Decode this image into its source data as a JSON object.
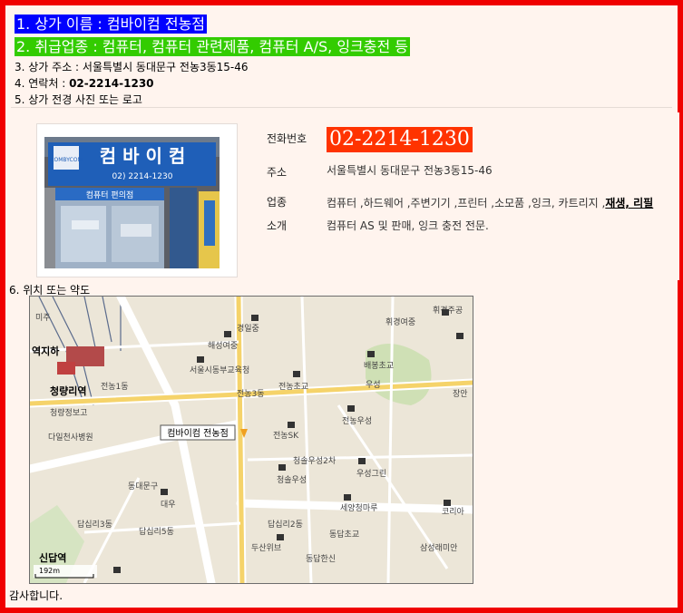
{
  "store": {
    "name_line": "1. 상가 이름 : 컴바이컴 전농점",
    "category_line": "2. 취급업종 : 컴퓨터, 컴퓨터 관련제품, 컴퓨터 A/S, 잉크충전 등",
    "address_line": "3. 상가 주소 : 서울특별시 동대문구 전농3동15-46",
    "contact_prefix": "4. 연락처 : ",
    "contact_phone": "02-2214-1230",
    "photo_line": "5. 상가 전경 사진 또는 로고",
    "map_line": "6. 위치 또는 약도",
    "thanks": "감사합니다."
  },
  "photo": {
    "sign_main": "컴 바 이 컴",
    "sign_phone": "02) 2214-1230",
    "sign_lower": "컴퓨터 편의점",
    "sign_logo": "COMBYCOM"
  },
  "info": {
    "phone_label": "전화번호",
    "phone_value": "02-2214-1230",
    "address_label": "주소",
    "address_value": "서울특별시 동대문구 전농3동15-46",
    "business_label": "업종",
    "business_value": "컴퓨터 ,하드웨어 ,주변기기 ,프린터 ,소모품 ,잉크, 카트리지 ,",
    "business_emph": "재생, 리필",
    "intro_label": "소개",
    "intro_value": "컴퓨터 AS 및 판매, 잉크 충전 전문."
  },
  "map": {
    "store_marker": "컴바이컴 전농점",
    "labels": [
      "미주",
      "경일중",
      "휘경여중",
      "휘경주공",
      "역지하",
      "해성여중",
      "서울시동부교육청",
      "배봉초교",
      "전농1동",
      "전농3동",
      "전농초교",
      "우성",
      "장안",
      "청량리역",
      "청량정보고",
      "다일천사병원",
      "전농SK",
      "전농우성",
      "청솔우성2차",
      "우성그린",
      "청솔우성",
      "동대문구",
      "대우",
      "세양청마루",
      "답십리3동",
      "답십리5동",
      "답십리2동",
      "동답초교",
      "코리아",
      "두산위브",
      "신답역",
      "동답한신",
      "삼성래미안"
    ],
    "scale_label": "192m"
  },
  "colors": {
    "frame": "#f00000",
    "highlight_blue": "#0000ff",
    "highlight_green": "#33cc00",
    "phone_bg": "#ff3300",
    "page_bg": "#fff4ee"
  }
}
